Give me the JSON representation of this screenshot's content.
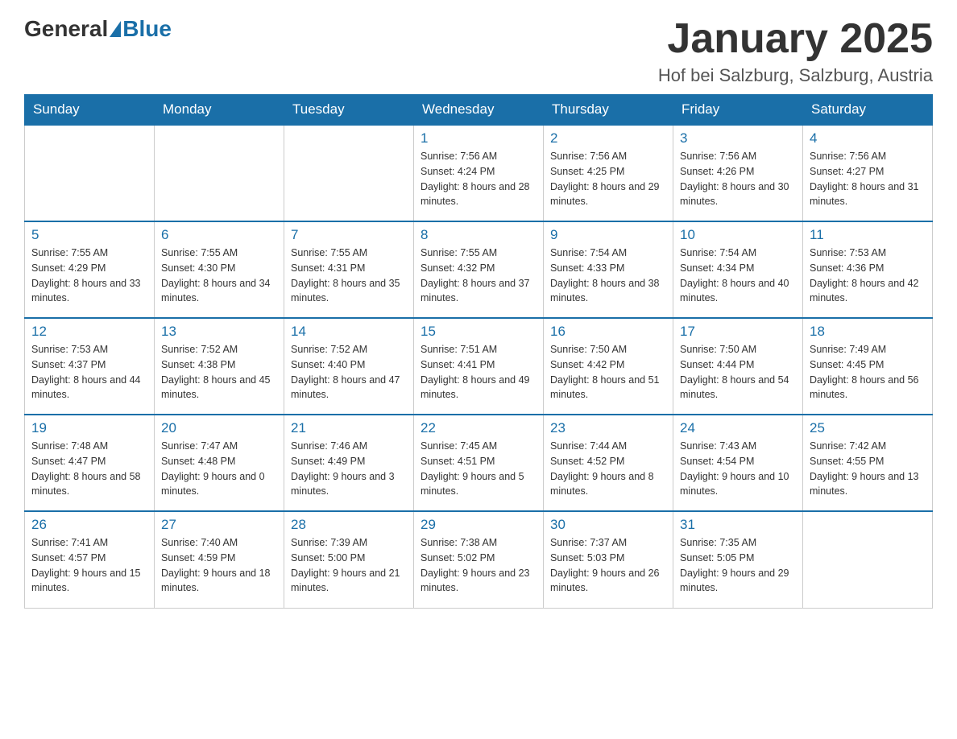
{
  "header": {
    "logo_general": "General",
    "logo_blue": "Blue",
    "month_title": "January 2025",
    "location": "Hof bei Salzburg, Salzburg, Austria"
  },
  "days_of_week": [
    "Sunday",
    "Monday",
    "Tuesday",
    "Wednesday",
    "Thursday",
    "Friday",
    "Saturday"
  ],
  "weeks": [
    [
      {
        "day": "",
        "sunrise": "",
        "sunset": "",
        "daylight": ""
      },
      {
        "day": "",
        "sunrise": "",
        "sunset": "",
        "daylight": ""
      },
      {
        "day": "",
        "sunrise": "",
        "sunset": "",
        "daylight": ""
      },
      {
        "day": "1",
        "sunrise": "Sunrise: 7:56 AM",
        "sunset": "Sunset: 4:24 PM",
        "daylight": "Daylight: 8 hours and 28 minutes."
      },
      {
        "day": "2",
        "sunrise": "Sunrise: 7:56 AM",
        "sunset": "Sunset: 4:25 PM",
        "daylight": "Daylight: 8 hours and 29 minutes."
      },
      {
        "day": "3",
        "sunrise": "Sunrise: 7:56 AM",
        "sunset": "Sunset: 4:26 PM",
        "daylight": "Daylight: 8 hours and 30 minutes."
      },
      {
        "day": "4",
        "sunrise": "Sunrise: 7:56 AM",
        "sunset": "Sunset: 4:27 PM",
        "daylight": "Daylight: 8 hours and 31 minutes."
      }
    ],
    [
      {
        "day": "5",
        "sunrise": "Sunrise: 7:55 AM",
        "sunset": "Sunset: 4:29 PM",
        "daylight": "Daylight: 8 hours and 33 minutes."
      },
      {
        "day": "6",
        "sunrise": "Sunrise: 7:55 AM",
        "sunset": "Sunset: 4:30 PM",
        "daylight": "Daylight: 8 hours and 34 minutes."
      },
      {
        "day": "7",
        "sunrise": "Sunrise: 7:55 AM",
        "sunset": "Sunset: 4:31 PM",
        "daylight": "Daylight: 8 hours and 35 minutes."
      },
      {
        "day": "8",
        "sunrise": "Sunrise: 7:55 AM",
        "sunset": "Sunset: 4:32 PM",
        "daylight": "Daylight: 8 hours and 37 minutes."
      },
      {
        "day": "9",
        "sunrise": "Sunrise: 7:54 AM",
        "sunset": "Sunset: 4:33 PM",
        "daylight": "Daylight: 8 hours and 38 minutes."
      },
      {
        "day": "10",
        "sunrise": "Sunrise: 7:54 AM",
        "sunset": "Sunset: 4:34 PM",
        "daylight": "Daylight: 8 hours and 40 minutes."
      },
      {
        "day": "11",
        "sunrise": "Sunrise: 7:53 AM",
        "sunset": "Sunset: 4:36 PM",
        "daylight": "Daylight: 8 hours and 42 minutes."
      }
    ],
    [
      {
        "day": "12",
        "sunrise": "Sunrise: 7:53 AM",
        "sunset": "Sunset: 4:37 PM",
        "daylight": "Daylight: 8 hours and 44 minutes."
      },
      {
        "day": "13",
        "sunrise": "Sunrise: 7:52 AM",
        "sunset": "Sunset: 4:38 PM",
        "daylight": "Daylight: 8 hours and 45 minutes."
      },
      {
        "day": "14",
        "sunrise": "Sunrise: 7:52 AM",
        "sunset": "Sunset: 4:40 PM",
        "daylight": "Daylight: 8 hours and 47 minutes."
      },
      {
        "day": "15",
        "sunrise": "Sunrise: 7:51 AM",
        "sunset": "Sunset: 4:41 PM",
        "daylight": "Daylight: 8 hours and 49 minutes."
      },
      {
        "day": "16",
        "sunrise": "Sunrise: 7:50 AM",
        "sunset": "Sunset: 4:42 PM",
        "daylight": "Daylight: 8 hours and 51 minutes."
      },
      {
        "day": "17",
        "sunrise": "Sunrise: 7:50 AM",
        "sunset": "Sunset: 4:44 PM",
        "daylight": "Daylight: 8 hours and 54 minutes."
      },
      {
        "day": "18",
        "sunrise": "Sunrise: 7:49 AM",
        "sunset": "Sunset: 4:45 PM",
        "daylight": "Daylight: 8 hours and 56 minutes."
      }
    ],
    [
      {
        "day": "19",
        "sunrise": "Sunrise: 7:48 AM",
        "sunset": "Sunset: 4:47 PM",
        "daylight": "Daylight: 8 hours and 58 minutes."
      },
      {
        "day": "20",
        "sunrise": "Sunrise: 7:47 AM",
        "sunset": "Sunset: 4:48 PM",
        "daylight": "Daylight: 9 hours and 0 minutes."
      },
      {
        "day": "21",
        "sunrise": "Sunrise: 7:46 AM",
        "sunset": "Sunset: 4:49 PM",
        "daylight": "Daylight: 9 hours and 3 minutes."
      },
      {
        "day": "22",
        "sunrise": "Sunrise: 7:45 AM",
        "sunset": "Sunset: 4:51 PM",
        "daylight": "Daylight: 9 hours and 5 minutes."
      },
      {
        "day": "23",
        "sunrise": "Sunrise: 7:44 AM",
        "sunset": "Sunset: 4:52 PM",
        "daylight": "Daylight: 9 hours and 8 minutes."
      },
      {
        "day": "24",
        "sunrise": "Sunrise: 7:43 AM",
        "sunset": "Sunset: 4:54 PM",
        "daylight": "Daylight: 9 hours and 10 minutes."
      },
      {
        "day": "25",
        "sunrise": "Sunrise: 7:42 AM",
        "sunset": "Sunset: 4:55 PM",
        "daylight": "Daylight: 9 hours and 13 minutes."
      }
    ],
    [
      {
        "day": "26",
        "sunrise": "Sunrise: 7:41 AM",
        "sunset": "Sunset: 4:57 PM",
        "daylight": "Daylight: 9 hours and 15 minutes."
      },
      {
        "day": "27",
        "sunrise": "Sunrise: 7:40 AM",
        "sunset": "Sunset: 4:59 PM",
        "daylight": "Daylight: 9 hours and 18 minutes."
      },
      {
        "day": "28",
        "sunrise": "Sunrise: 7:39 AM",
        "sunset": "Sunset: 5:00 PM",
        "daylight": "Daylight: 9 hours and 21 minutes."
      },
      {
        "day": "29",
        "sunrise": "Sunrise: 7:38 AM",
        "sunset": "Sunset: 5:02 PM",
        "daylight": "Daylight: 9 hours and 23 minutes."
      },
      {
        "day": "30",
        "sunrise": "Sunrise: 7:37 AM",
        "sunset": "Sunset: 5:03 PM",
        "daylight": "Daylight: 9 hours and 26 minutes."
      },
      {
        "day": "31",
        "sunrise": "Sunrise: 7:35 AM",
        "sunset": "Sunset: 5:05 PM",
        "daylight": "Daylight: 9 hours and 29 minutes."
      },
      {
        "day": "",
        "sunrise": "",
        "sunset": "",
        "daylight": ""
      }
    ]
  ]
}
